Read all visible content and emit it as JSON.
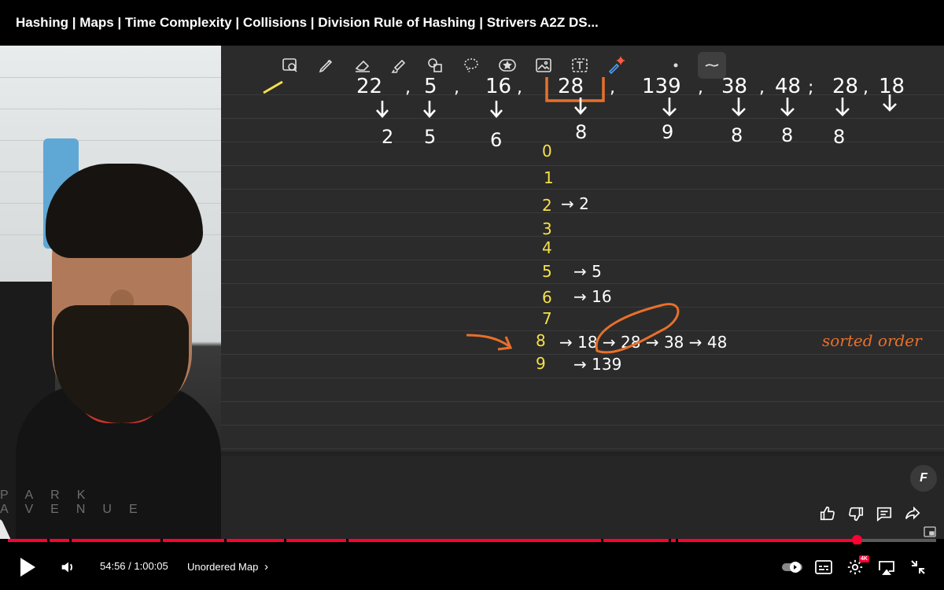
{
  "window": {
    "title": "Hashing | Maps | Time Complexity | Collisions | Division Rule of Hashing | Strivers A2Z DS..."
  },
  "webcam": {
    "brand_text": "PARK AVENUE"
  },
  "toolbar": {
    "tools": [
      "image-lasso-icon",
      "pen-icon",
      "eraser-icon",
      "highlighter-icon",
      "shapes-icon",
      "lasso-icon",
      "sticker-icon",
      "image-icon",
      "text-box-icon",
      "laser-pointer-icon",
      "dot-icon",
      "stroke-width-icon"
    ],
    "selected": "stroke-width-icon"
  },
  "whiteboard": {
    "input_row": [
      "22",
      "5",
      "16",
      "28",
      "139",
      "38",
      "48",
      "28",
      "18"
    ],
    "mod_row": [
      "2",
      "5",
      "6",
      "8",
      "9",
      "8",
      "8",
      "8"
    ],
    "buckets": [
      "0",
      "1",
      "2",
      "3",
      "4",
      "5",
      "6",
      "7",
      "8",
      "9"
    ],
    "entries": {
      "2": "→ 2",
      "5": "→ 5",
      "6": "→ 16",
      "8": "→ 18 → 28 → 38 → 48",
      "9": "→ 139"
    },
    "annotation": "sorted order",
    "colors": {
      "ink": "#ffffff",
      "bucket_index": "#f5e04a",
      "highlight": "#e8702a",
      "board": "#2b2b2b"
    }
  },
  "overlay": {
    "fab_label": "F"
  },
  "player": {
    "current_time": "54:56",
    "duration": "1:00:05",
    "time_display": "54:56 / 1:00:05",
    "chapter": "Unordered Map",
    "chapter_chevron": "›",
    "quality_badge": "4K",
    "progress_fraction": 0.914,
    "colors": {
      "progress": "#ff0033",
      "track": "#5a5a5a"
    }
  }
}
